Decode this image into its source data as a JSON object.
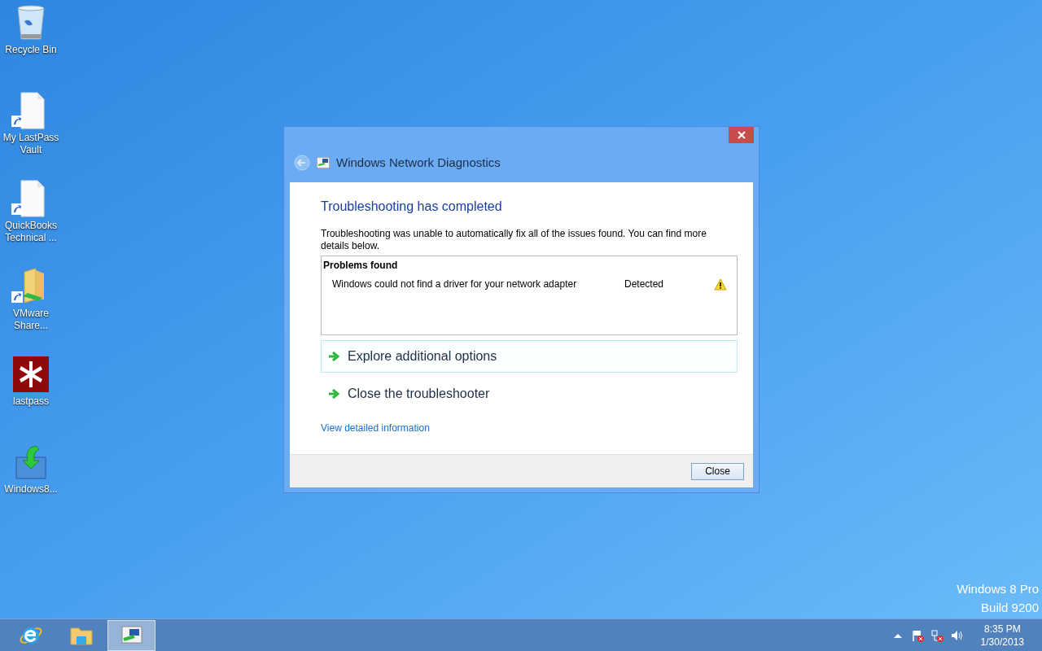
{
  "desktop_icons": [
    {
      "kind": "recycle-bin",
      "label": "Recycle Bin"
    },
    {
      "kind": "document-shortcut",
      "label": "My LastPass Vault"
    },
    {
      "kind": "document-shortcut",
      "label": "QuickBooks Technical ..."
    },
    {
      "kind": "folder-shortcut",
      "label": "VMware Share..."
    },
    {
      "kind": "lastpass",
      "label": "lastpass"
    },
    {
      "kind": "installer",
      "label": "Windows8..."
    }
  ],
  "dialog": {
    "title": "Windows Network Diagnostics",
    "heading": "Troubleshooting has completed",
    "message": "Troubleshooting was unable to automatically fix all of the issues found. You can find more details below.",
    "problems": {
      "header": "Problems found",
      "rows": [
        {
          "problem": "Windows could not find a driver for your network adapter",
          "status": "Detected",
          "kind": "warning"
        }
      ]
    },
    "options": [
      {
        "label": "Explore additional options",
        "selected": true
      },
      {
        "label": "Close the troubleshooter",
        "selected": false
      }
    ],
    "link": "View detailed information",
    "close_button": "Close"
  },
  "watermark": {
    "edition": "Windows 8 Pro",
    "build": "Build 9200"
  },
  "taskbar": {
    "apps": [
      {
        "kind": "browser",
        "selected": false
      },
      {
        "kind": "file-explorer",
        "selected": false
      },
      {
        "kind": "network-diagnostics",
        "selected": true
      }
    ],
    "tray": [
      {
        "kind": "caret"
      },
      {
        "kind": "flag-error"
      },
      {
        "kind": "network-error"
      },
      {
        "kind": "speaker"
      }
    ],
    "time": "8:35 PM",
    "date": "1/30/2013"
  }
}
